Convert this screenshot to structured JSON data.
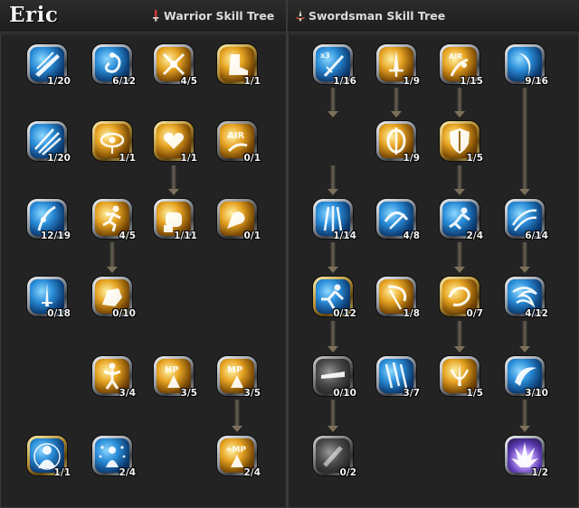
{
  "header": {
    "character_name": "Eric",
    "trees": [
      {
        "label": "Warrior Skill Tree",
        "icon": "warrior-emblem-icon",
        "color": "#d23a3a"
      },
      {
        "label": "Swordsman Skill Tree",
        "icon": "swordsman-emblem-icon",
        "color": "#e0603a"
      }
    ]
  },
  "warrior_skills": [
    {
      "level": "1/20",
      "style": "silver",
      "tint": "blue",
      "icon": "slash-icon"
    },
    {
      "level": "6/12",
      "style": "silver",
      "tint": "blue",
      "icon": "spiral-kick-icon"
    },
    {
      "level": "4/5",
      "style": "silver",
      "tint": "gold",
      "icon": "crossed-swords-icon"
    },
    {
      "level": "1/1",
      "style": "gold",
      "tint": "gold",
      "icon": "boot-icon"
    },
    {
      "level": "1/20",
      "style": "silver",
      "tint": "blue",
      "icon": "claw-slash-icon"
    },
    {
      "level": "1/1",
      "style": "gold",
      "tint": "gold",
      "icon": "eye-icon"
    },
    {
      "level": "1/1",
      "style": "gold",
      "tint": "gold",
      "icon": "heart-hand-icon"
    },
    {
      "level": "0/1",
      "style": "grey",
      "tint": "gold",
      "icon": "air-icon"
    },
    {
      "level": "12/19",
      "style": "silver",
      "tint": "blue",
      "icon": "upper-slash-icon"
    },
    {
      "level": "4/5",
      "style": "silver",
      "tint": "gold",
      "icon": "running-man-icon"
    },
    {
      "level": "1/11",
      "style": "silver",
      "tint": "gold",
      "icon": "fist-icon"
    },
    {
      "level": "0/1",
      "style": "grey",
      "tint": "gold",
      "icon": "muscle-icon"
    },
    {
      "level": "0/18",
      "style": "silver",
      "tint": "blue",
      "icon": "stab-icon"
    },
    {
      "level": "0/10",
      "style": "silver",
      "tint": "gold",
      "icon": "heavy-fist-icon"
    },
    {
      "level": "3/4",
      "style": "silver",
      "tint": "gold",
      "icon": "flex-man-icon"
    },
    {
      "level": "3/5",
      "style": "silver",
      "tint": "gold",
      "icon": "hp-icon"
    },
    {
      "level": "3/5",
      "style": "silver",
      "tint": "gold",
      "icon": "mp-icon"
    },
    {
      "level": "1/1",
      "style": "gold",
      "tint": "blue",
      "icon": "aura-man-icon"
    },
    {
      "level": "2/4",
      "style": "silver",
      "tint": "blue",
      "icon": "sparkle-man-icon"
    },
    {
      "level": "2/4",
      "style": "silver",
      "tint": "gold",
      "icon": "mp-plus-icon"
    }
  ],
  "swordsman_skills": [
    {
      "level": "1/16",
      "style": "silver",
      "tint": "blue",
      "icon": "x3-sword-icon"
    },
    {
      "level": "1/9",
      "style": "silver",
      "tint": "gold",
      "icon": "sword-rise-icon"
    },
    {
      "level": "1/15",
      "style": "silver",
      "tint": "gold",
      "icon": "air-jump-icon"
    },
    {
      "level": "9/16",
      "style": "silver",
      "tint": "blue",
      "icon": "crescent-slash-icon"
    },
    {
      "level": "1/9",
      "style": "silver",
      "tint": "gold",
      "icon": "parry-ring-icon"
    },
    {
      "level": "1/5",
      "style": "gold",
      "tint": "gold",
      "icon": "shield-icon"
    },
    {
      "level": "1/14",
      "style": "silver",
      "tint": "blue",
      "icon": "triple-blade-icon"
    },
    {
      "level": "4/8",
      "style": "silver",
      "tint": "blue",
      "icon": "spin-arc-icon"
    },
    {
      "level": "2/4",
      "style": "silver",
      "tint": "blue",
      "icon": "leap-strike-icon"
    },
    {
      "level": "6/14",
      "style": "silver",
      "tint": "blue",
      "icon": "wind-slash-icon"
    },
    {
      "level": "0/12",
      "style": "gold",
      "tint": "blue",
      "icon": "lunge-icon"
    },
    {
      "level": "1/8",
      "style": "silver",
      "tint": "gold",
      "icon": "sickle-icon"
    },
    {
      "level": "0/7",
      "style": "gold",
      "tint": "gold",
      "icon": "whirl-icon"
    },
    {
      "level": "4/12",
      "style": "silver",
      "tint": "blue",
      "icon": "cyclone-icon"
    },
    {
      "level": "0/10",
      "style": "grey",
      "tint": "grey",
      "icon": "blade-icon"
    },
    {
      "level": "3/7",
      "style": "silver",
      "tint": "blue",
      "icon": "rain-blades-icon"
    },
    {
      "level": "1/5",
      "style": "silver",
      "tint": "gold",
      "icon": "sword-shield-icon"
    },
    {
      "level": "3/10",
      "style": "silver",
      "tint": "blue",
      "icon": "moon-cut-icon"
    },
    {
      "level": "0/2",
      "style": "grey",
      "tint": "grey",
      "icon": "shadow-slash-icon"
    },
    {
      "level": "1/2",
      "style": "silver",
      "tint": "violet",
      "icon": "crystal-burst-icon"
    }
  ]
}
